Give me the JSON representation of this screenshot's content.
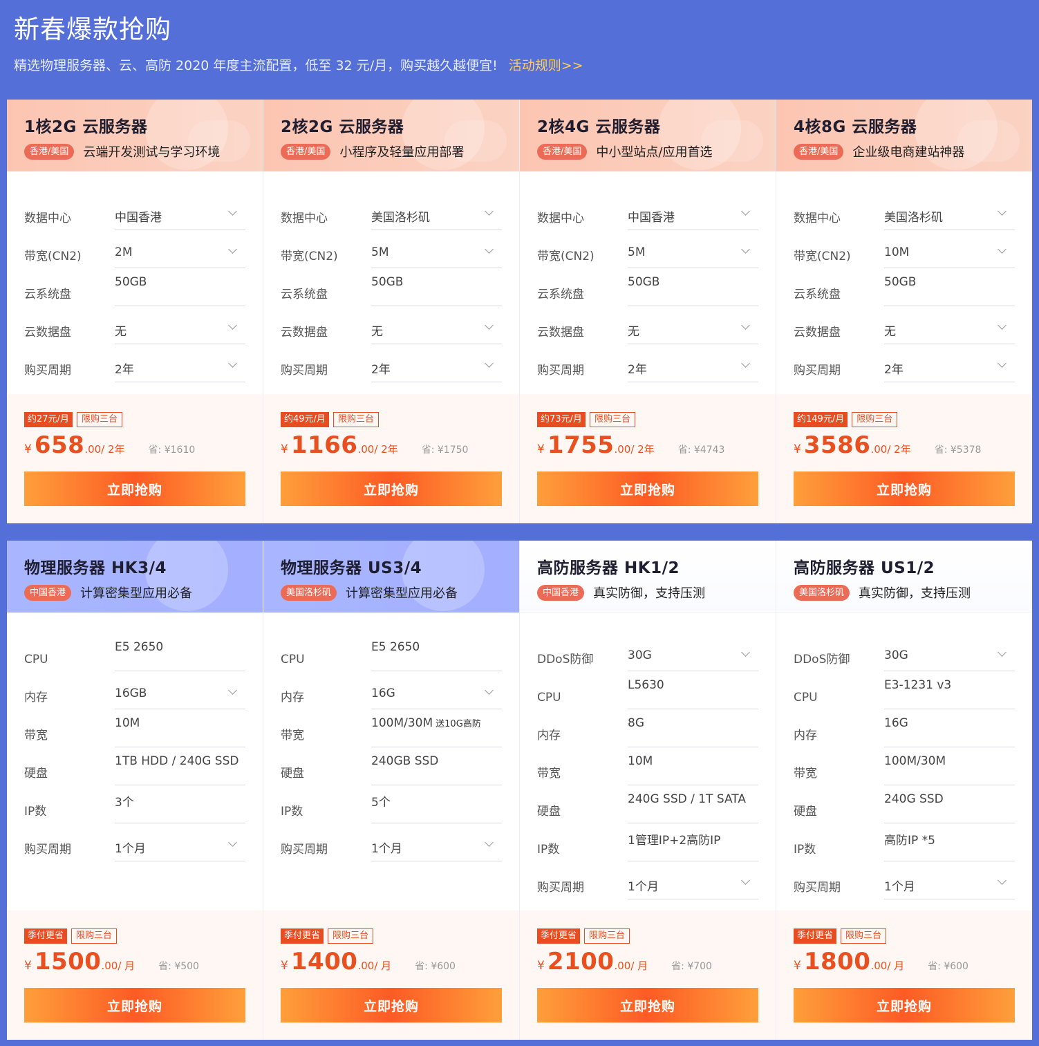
{
  "header": {
    "title": "新春爆款抢购",
    "subtitle": "精选物理服务器、云、高防 2020 年度主流配置，低至 32 元/月，购买越久越便宜!",
    "rules_link": "活动规则>>"
  },
  "common": {
    "buy_label": "立即抢购",
    "currency": "¥",
    "saved_prefix": "省: ¥",
    "limit_tag": "限购三台",
    "quarter_tag": "季付更省"
  },
  "cloud": [
    {
      "title": "1核2G 云服务器",
      "region": "香港/美国",
      "desc": "云端开发测试与学习环境",
      "specs": [
        {
          "label": "数据中心",
          "value": "中国香港"
        },
        {
          "label": "带宽(CN2)",
          "value": "2M"
        },
        {
          "label": "云系统盘",
          "value": "50GB"
        },
        {
          "label": "云数据盘",
          "value": "无"
        },
        {
          "label": "购买周期",
          "value": "2年"
        }
      ],
      "monthly_tag": "约27元/月",
      "price": "658",
      "unit": ".00/ 2年",
      "saved": "1610"
    },
    {
      "title": "2核2G 云服务器",
      "region": "香港/美国",
      "desc": "小程序及轻量应用部署",
      "specs": [
        {
          "label": "数据中心",
          "value": "美国洛杉矶"
        },
        {
          "label": "带宽(CN2)",
          "value": "5M"
        },
        {
          "label": "云系统盘",
          "value": "50GB"
        },
        {
          "label": "云数据盘",
          "value": "无"
        },
        {
          "label": "购买周期",
          "value": "2年"
        }
      ],
      "monthly_tag": "约49元/月",
      "price": "1166",
      "unit": ".00/ 2年",
      "saved": "1750"
    },
    {
      "title": "2核4G 云服务器",
      "region": "香港/美国",
      "desc": "中小型站点/应用首选",
      "specs": [
        {
          "label": "数据中心",
          "value": "中国香港"
        },
        {
          "label": "带宽(CN2)",
          "value": "5M"
        },
        {
          "label": "云系统盘",
          "value": "50GB"
        },
        {
          "label": "云数据盘",
          "value": "无"
        },
        {
          "label": "购买周期",
          "value": "2年"
        }
      ],
      "monthly_tag": "约73元/月",
      "price": "1755",
      "unit": ".00/ 2年",
      "saved": "4743"
    },
    {
      "title": "4核8G 云服务器",
      "region": "香港/美国",
      "desc": "企业级电商建站神器",
      "specs": [
        {
          "label": "数据中心",
          "value": "美国洛杉矶"
        },
        {
          "label": "带宽(CN2)",
          "value": "10M"
        },
        {
          "label": "云系统盘",
          "value": "50GB"
        },
        {
          "label": "云数据盘",
          "value": "无"
        },
        {
          "label": "购买周期",
          "value": "2年"
        }
      ],
      "monthly_tag": "约149元/月",
      "price": "3586",
      "unit": ".00/ 2年",
      "saved": "5378"
    }
  ],
  "servers": [
    {
      "title": "物理服务器 HK3/4",
      "region": "中国香港",
      "desc": "计算密集型应用必备",
      "specs": [
        {
          "label": "CPU",
          "value": "E5 2650"
        },
        {
          "label": "内存",
          "value": "16GB"
        },
        {
          "label": "带宽",
          "value": "10M"
        },
        {
          "label": "硬盘",
          "value": "1TB HDD / 240G SSD"
        },
        {
          "label": "IP数",
          "value": "3个"
        },
        {
          "label": "购买周期",
          "value": "1个月"
        }
      ],
      "price": "1500",
      "unit": ".00/ 月",
      "saved": "500"
    },
    {
      "title": "物理服务器 US3/4",
      "region": "美国洛杉矶",
      "desc": "计算密集型应用必备",
      "specs": [
        {
          "label": "CPU",
          "value": "E5 2650"
        },
        {
          "label": "内存",
          "value": "16G"
        },
        {
          "label": "带宽",
          "value": "100M/30M",
          "extra": "送10G高防"
        },
        {
          "label": "硬盘",
          "value": "240GB SSD"
        },
        {
          "label": "IP数",
          "value": "5个"
        },
        {
          "label": "购买周期",
          "value": "1个月"
        }
      ],
      "price": "1400",
      "unit": ".00/ 月",
      "saved": "600"
    },
    {
      "title": "高防服务器 HK1/2",
      "region": "中国香港",
      "desc": "真实防御，支持压测",
      "specs": [
        {
          "label": "DDoS防御",
          "value": "30G"
        },
        {
          "label": "CPU",
          "value": "L5630"
        },
        {
          "label": "内存",
          "value": "8G"
        },
        {
          "label": "带宽",
          "value": "10M"
        },
        {
          "label": "硬盘",
          "value": "240G SSD / 1T SATA"
        },
        {
          "label": "IP数",
          "value": "1管理IP+2高防IP"
        },
        {
          "label": "购买周期",
          "value": "1个月"
        }
      ],
      "price": "2100",
      "unit": ".00/ 月",
      "saved": "700"
    },
    {
      "title": "高防服务器 US1/2",
      "region": "美国洛杉矶",
      "desc": "真实防御，支持压测",
      "specs": [
        {
          "label": "DDoS防御",
          "value": "30G"
        },
        {
          "label": "CPU",
          "value": "E3-1231 v3"
        },
        {
          "label": "内存",
          "value": "16G"
        },
        {
          "label": "带宽",
          "value": "100M/30M"
        },
        {
          "label": "硬盘",
          "value": "240G SSD"
        },
        {
          "label": "IP数",
          "value": "高防IP *5"
        },
        {
          "label": "购买周期",
          "value": "1个月"
        }
      ],
      "price": "1800",
      "unit": ".00/ 月",
      "saved": "600"
    }
  ]
}
